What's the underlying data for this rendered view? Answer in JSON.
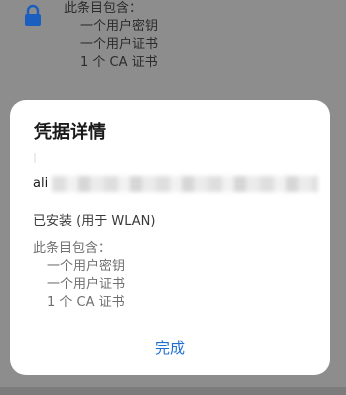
{
  "background": {
    "contains_label": "此条目包含：",
    "items": [
      "一个用户密钥",
      "一个用户证书",
      "1 个 CA 证书"
    ],
    "icon": "lock-icon",
    "accent_color": "#1f6fd1"
  },
  "dialog": {
    "title": "凭据详情",
    "cert_name": "ali",
    "install_info": "已安装 (用于 WLAN)",
    "contains_label": "此条目包含：",
    "items": [
      "一个用户密钥",
      "一个用户证书",
      "1 个 CA 证书"
    ],
    "done_label": "完成"
  }
}
